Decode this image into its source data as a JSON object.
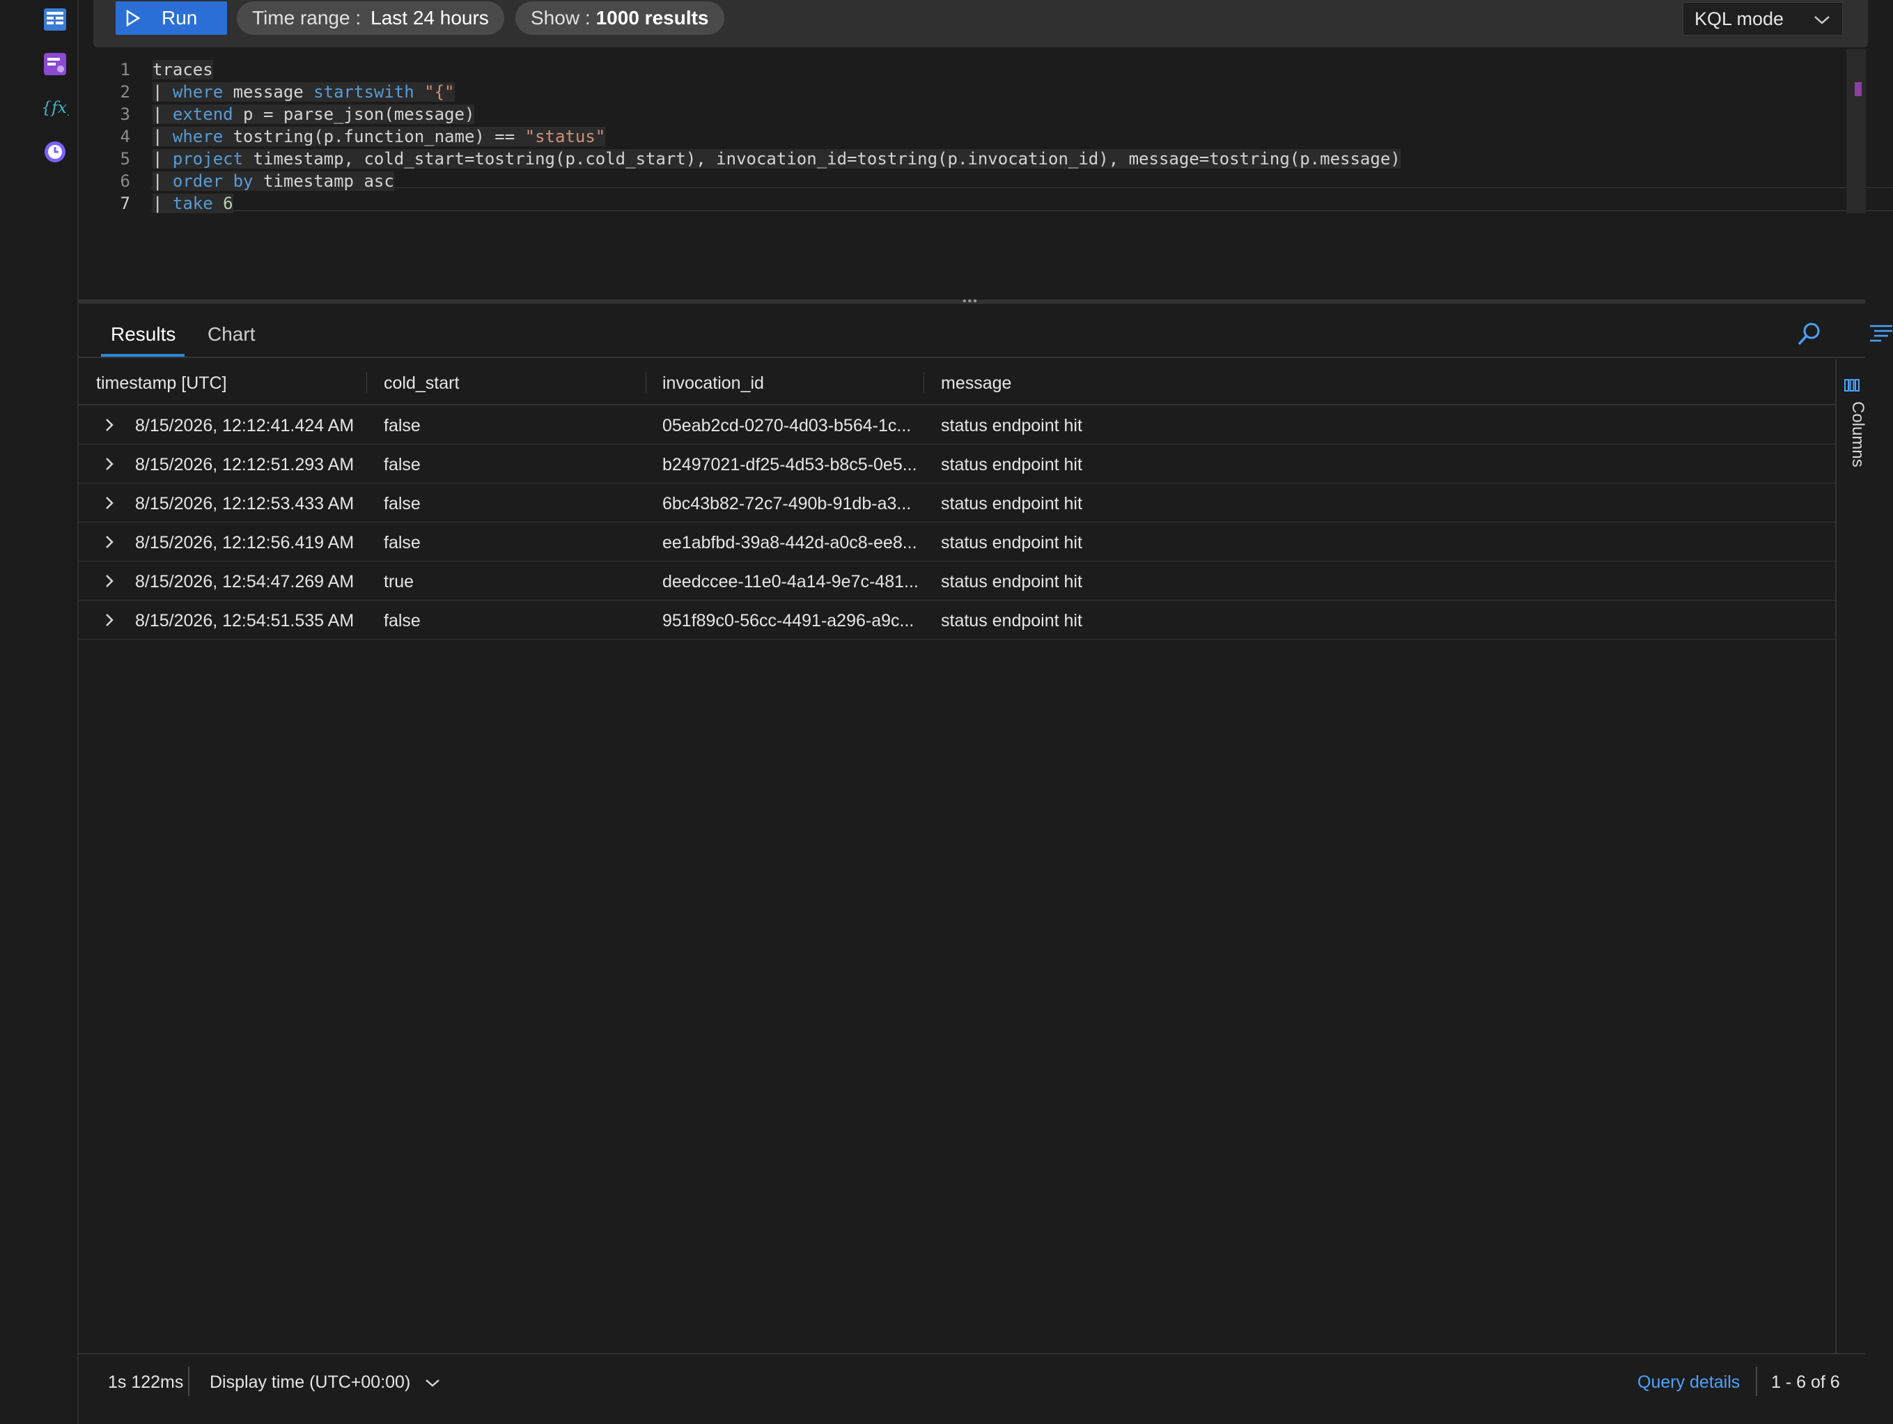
{
  "toolbar": {
    "run_label": "Run",
    "time_range_label": "Time range :",
    "time_range_value": "Last 24 hours",
    "show_label": "Show :",
    "show_value": "1000 results",
    "mode_label": "KQL mode"
  },
  "rail_icons": [
    "tables-icon",
    "queries-icon",
    "functions-icon",
    "history-icon"
  ],
  "editor": {
    "line_numbers": [
      "1",
      "2",
      "3",
      "4",
      "5",
      "6",
      "7"
    ],
    "lines": {
      "l1": "traces",
      "l2_kw": "where",
      "l2_mid": " message ",
      "l2_kw2": "startswith",
      "l2_str": "\"{\"",
      "l3_kw": "extend",
      "l3_rest": " p = parse_json(message)",
      "l4_kw": "where",
      "l4_rest": " tostring(p.function_name) == ",
      "l4_str": "\"status\"",
      "l5_kw": "project",
      "l5_rest": " timestamp, cold_start=tostring(p.cold_start), invocation_id=tostring(p.invocation_id), message=tostring(p.message)",
      "l6_kw": "order by",
      "l6_rest": " timestamp asc",
      "l7_kw": "take",
      "l7_num": "6"
    }
  },
  "results": {
    "tabs": [
      "Results",
      "Chart"
    ],
    "columns": [
      "timestamp [UTC]",
      "cold_start",
      "invocation_id",
      "message"
    ],
    "rows": [
      {
        "timestamp": "8/15/2026, 12:12:41.424 AM",
        "cold_start": "false",
        "invocation_id": "05eab2cd-0270-4d03-b564-1c...",
        "message": "status endpoint hit"
      },
      {
        "timestamp": "8/15/2026, 12:12:51.293 AM",
        "cold_start": "false",
        "invocation_id": "b2497021-df25-4d53-b8c5-0e5...",
        "message": "status endpoint hit"
      },
      {
        "timestamp": "8/15/2026, 12:12:53.433 AM",
        "cold_start": "false",
        "invocation_id": "6bc43b82-72c7-490b-91db-a3...",
        "message": "status endpoint hit"
      },
      {
        "timestamp": "8/15/2026, 12:12:56.419 AM",
        "cold_start": "false",
        "invocation_id": "ee1abfbd-39a8-442d-a0c8-ee8...",
        "message": "status endpoint hit"
      },
      {
        "timestamp": "8/15/2026, 12:54:47.269 AM",
        "cold_start": "true",
        "invocation_id": "deedccee-11e0-4a14-9e7c-481...",
        "message": "status endpoint hit"
      },
      {
        "timestamp": "8/15/2026, 12:54:51.535 AM",
        "cold_start": "false",
        "invocation_id": "951f89c0-56cc-4491-a296-a9c...",
        "message": "status endpoint hit"
      }
    ],
    "columns_panel_label": "Columns"
  },
  "footer": {
    "duration": "1s 122ms",
    "display_time": "Display time (UTC+00:00)",
    "query_details": "Query details",
    "count": "1 - 6 of 6"
  },
  "colors": {
    "accent": "#2b6fd6",
    "link": "#4aa3ff",
    "keyword": "#569cd6",
    "string": "#ce9178",
    "number": "#b5cea8"
  }
}
